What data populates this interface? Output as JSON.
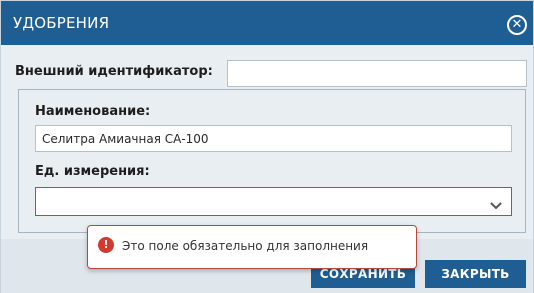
{
  "dialog": {
    "title": "УДОБРЕНИЯ",
    "close_icon": "close-circle-icon"
  },
  "form": {
    "external_id": {
      "label": "Внешний идентификатор:",
      "value": ""
    },
    "name": {
      "label": "Наименование:",
      "value": "Селитра Амиачная СА-100"
    },
    "unit": {
      "label": "Ед. измерения:",
      "value": "",
      "dropdown_icon": "chevron-down-icon"
    }
  },
  "validation": {
    "message": "Это поле обязательно для заполнения",
    "icon": "error-icon",
    "color": "#d23a2f"
  },
  "buttons": {
    "save_label": "СОХРАНИТЬ",
    "close_label": "ЗАКРЫТЬ"
  },
  "colors": {
    "header": "#1f5e93",
    "error_border": "#b44a3f",
    "panel_bg": "#e9eef2"
  }
}
